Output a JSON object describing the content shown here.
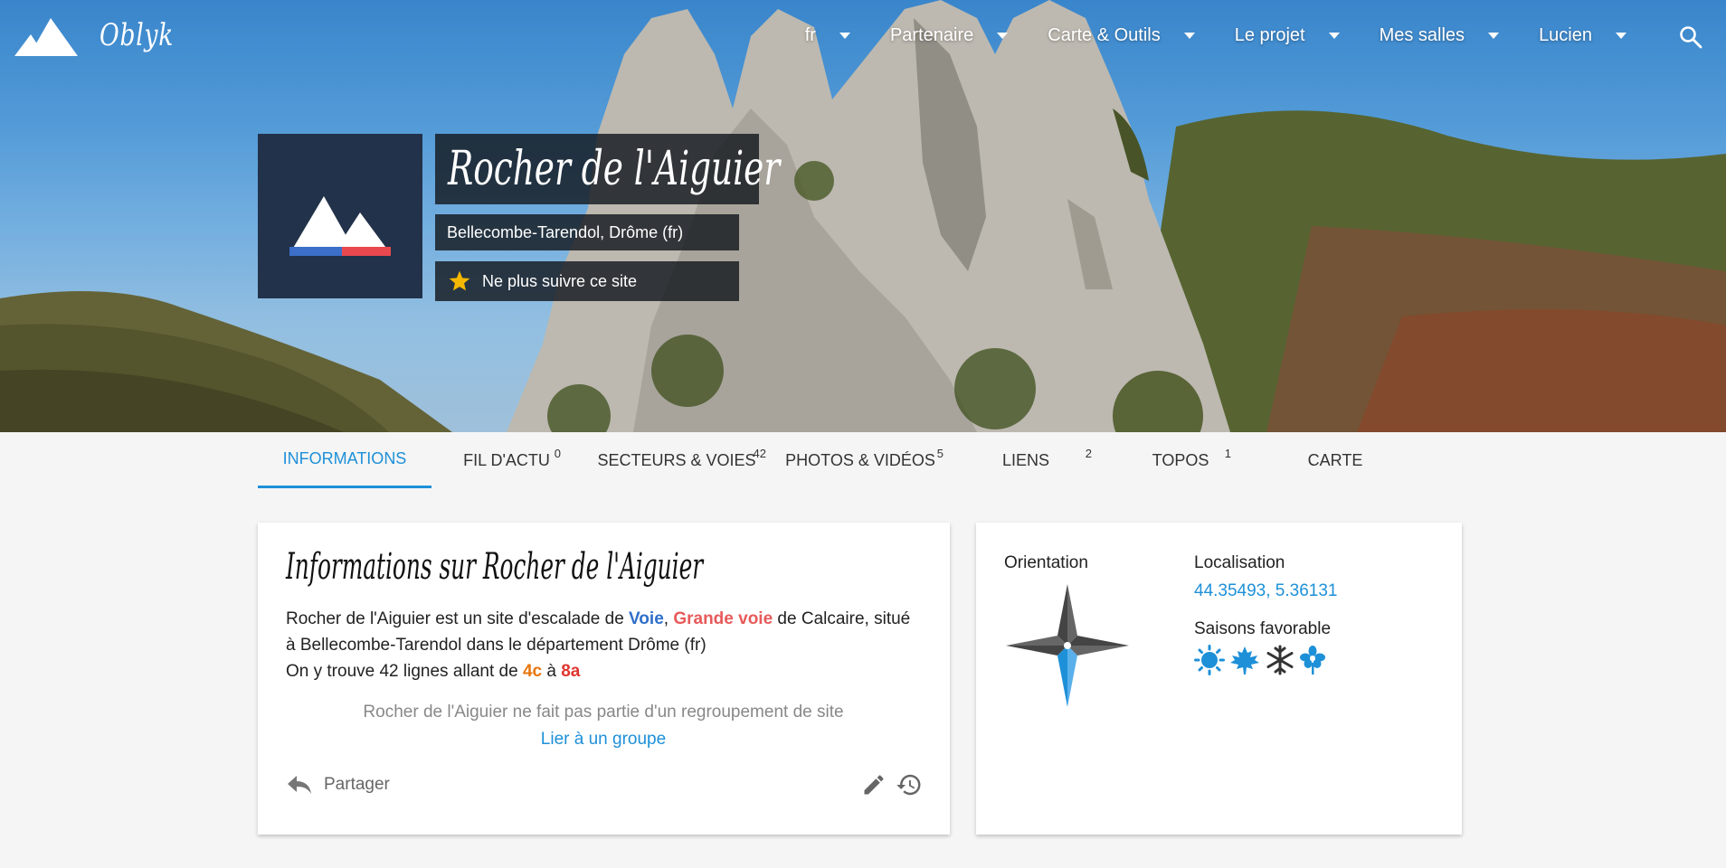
{
  "brand": {
    "name": "Oblyk"
  },
  "nav": {
    "items": [
      {
        "label": "fr"
      },
      {
        "label": "Partenaire"
      },
      {
        "label": "Carte & Outils"
      },
      {
        "label": "Le projet"
      },
      {
        "label": "Mes salles"
      },
      {
        "label": "Lucien"
      }
    ]
  },
  "site": {
    "title": "Rocher de l'Aiguier",
    "location": "Bellecombe-Tarendol, Drôme (fr)",
    "follow_label": "Ne plus suivre ce site"
  },
  "tabs": [
    {
      "label": "INFORMATIONS",
      "count": ""
    },
    {
      "label": "FIL D'ACTU",
      "count": "0"
    },
    {
      "label": "SECTEURS & VOIES",
      "count": "42"
    },
    {
      "label": "PHOTOS & VIDÉOS",
      "count": "5"
    },
    {
      "label": "LIENS",
      "count": "2"
    },
    {
      "label": "TOPOS",
      "count": "1"
    },
    {
      "label": "CARTE",
      "count": ""
    }
  ],
  "info": {
    "title": "Informations sur Rocher de l'Aiguier",
    "desc_prefix": "Rocher de l'Aiguier est un site d'escalade de ",
    "voie": "Voie",
    "comma": ", ",
    "grande_voie": "Grande voie",
    "desc_middle": " de Calcaire, situé à Bellecombe-Tarendol dans le département Drôme (fr)",
    "lines_prefix": "On y trouve 42 lignes allant de ",
    "grade_min": "4c",
    "a_word": " à ",
    "grade_max": "8a",
    "group_note": "Rocher de l'Aiguier ne fait pas partie d'un regroupement de site",
    "group_link": "Lier à un groupe",
    "share_label": "Partager"
  },
  "meta": {
    "orientation_label": "Orientation",
    "localisation_label": "Localisation",
    "coords": "44.35493, 5.36131",
    "seasons_label": "Saisons favorable",
    "season_icons": [
      "sun-icon",
      "maple-leaf-icon",
      "snowflake-icon",
      "flower-icon"
    ]
  },
  "colors": {
    "accent": "#1e90d8",
    "site_card_bg": "#22324a",
    "voie": "#2f6fca",
    "grande_voie": "#e85a5a",
    "grade_min": "#e8760e",
    "grade_max": "#e0352f"
  }
}
